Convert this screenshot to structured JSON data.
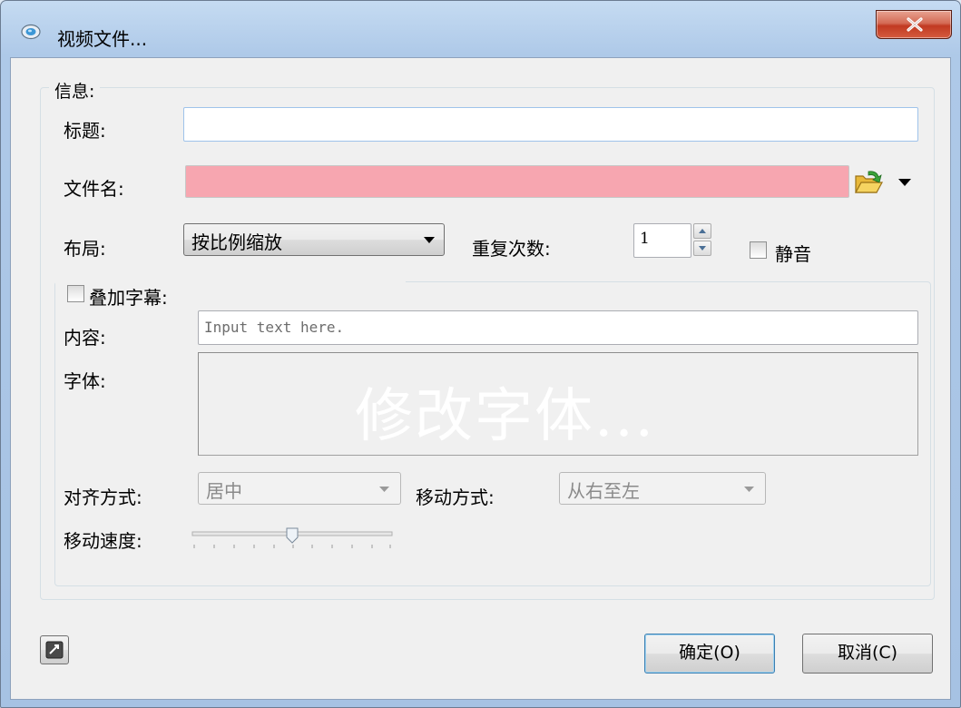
{
  "window": {
    "title": "视频文件...",
    "close_icon": "close-icon"
  },
  "info_group": {
    "label": "信息:",
    "title_label": "标题:",
    "title_value": "",
    "filename_label": "文件名:",
    "filename_value": "",
    "filename_color": "#f7a6b0",
    "layout_label": "布局:",
    "layout_value": "按比例缩放",
    "repeat_label": "重复次数:",
    "repeat_value": "1",
    "mute_label": "静音",
    "mute_checked": false
  },
  "caption_group": {
    "enable_label": "叠加字幕:",
    "enable_checked": false,
    "content_label": "内容:",
    "content_placeholder": "Input text here.",
    "font_label": "字体:",
    "font_preview_text": "修改字体...",
    "align_label": "对齐方式:",
    "align_value": "居中",
    "move_label": "移动方式:",
    "move_value": "从右至左",
    "speed_label": "移动速度:",
    "speed_value": 0.5
  },
  "buttons": {
    "ok": "确定(O)",
    "cancel": "取消(C)"
  },
  "icons": {
    "app": "video-file-icon",
    "browse": "folder-open-icon",
    "dropdown": "triangle-down-icon",
    "small_button": "edit-icon"
  }
}
